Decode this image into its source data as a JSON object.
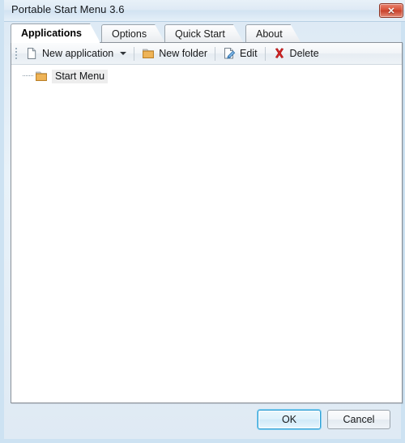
{
  "window": {
    "title": "Portable Start Menu 3.6",
    "close_label": "✕",
    "close_icon": "close-icon",
    "accent_blue": "#2f9fd4",
    "close_red": "#d9533a",
    "folder_amber": "#e8a33d"
  },
  "tabs": [
    {
      "label": "Applications",
      "active": true
    },
    {
      "label": "Options",
      "active": false
    },
    {
      "label": "Quick Start",
      "active": false
    },
    {
      "label": "About",
      "active": false
    }
  ],
  "toolbar": {
    "grip_icon": "drag-grip-icon",
    "items": [
      {
        "label": "New application",
        "icon": "new-document-icon",
        "has_caret": true
      },
      {
        "label": "New folder",
        "icon": "new-folder-icon",
        "has_caret": false
      },
      {
        "label": "Edit",
        "icon": "edit-pencil-icon",
        "has_caret": false
      },
      {
        "label": "Delete",
        "icon": "delete-x-icon",
        "has_caret": false
      }
    ]
  },
  "tree": {
    "nodes": [
      {
        "label": "Start Menu",
        "icon": "folder-icon",
        "selected": true
      }
    ]
  },
  "footer": {
    "ok_label": "OK",
    "cancel_label": "Cancel"
  }
}
